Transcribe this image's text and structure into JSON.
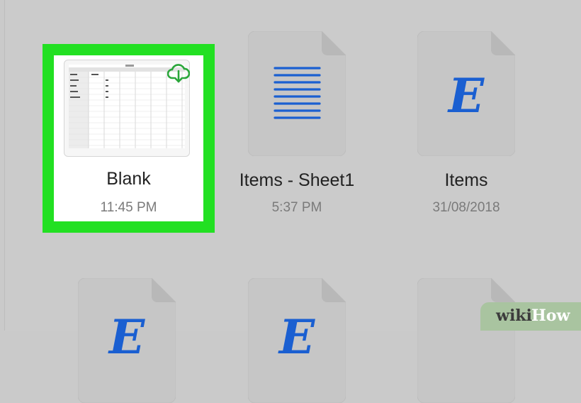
{
  "files": [
    {
      "name": "Blank",
      "subtitle": "11:45 PM",
      "thumbnail": "spreadsheet-thumbnail",
      "badge": "cloud-download-icon",
      "selected": true
    },
    {
      "name": "Items - Sheet1",
      "subtitle": "5:37 PM",
      "thumbnail": "text-lines-icon",
      "selected": false
    },
    {
      "name": "Items",
      "subtitle": "31/08/2018",
      "thumbnail": "letter-e-icon",
      "glyph": "E",
      "selected": false
    }
  ],
  "partial_row_glyph": "E",
  "colors": {
    "highlight": "#22e022",
    "icon_blue": "#1a5fd1",
    "background": "#cbcbcb"
  },
  "watermark": {
    "part1": "wiki",
    "part2": "How"
  }
}
